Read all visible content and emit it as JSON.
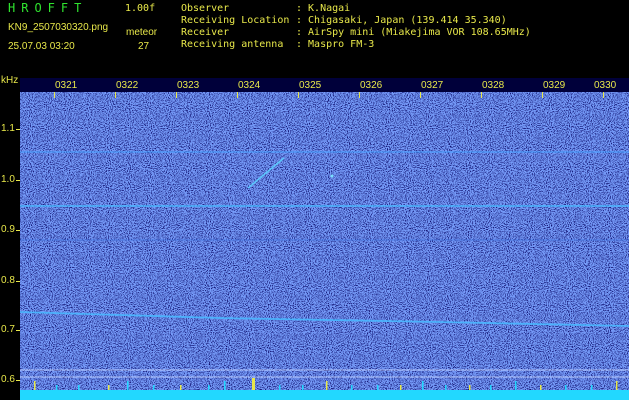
{
  "header": {
    "app_name": "HROFFT",
    "version": "1.00f",
    "filename": "KN9_2507030320.png",
    "mode": "meteor",
    "datetime": "25.07.03 03:20",
    "count": "27"
  },
  "info": [
    {
      "key": "Observer",
      "value": ": K.Nagai"
    },
    {
      "key": "Receiving Location",
      "value": ": Chigasaki, Japan (139.414 35.340)"
    },
    {
      "key": "Receiver",
      "value": ": AirSpy mini (Miakejima VOR 108.65MHz)"
    },
    {
      "key": "Receiving antenna",
      "value": ": Maspro FM-3"
    }
  ],
  "spectrogram": {
    "unit_label": "kHz",
    "freq_labels": [
      "1.1",
      "1.0",
      "0.9",
      "0.8",
      "0.7",
      "0.6"
    ],
    "time_labels": [
      "0321",
      "0322",
      "0323",
      "0324",
      "0325",
      "0326",
      "0327",
      "0328",
      "0329",
      "0330"
    ],
    "colors": {
      "background": "#0a0a6a",
      "noise_bright": "#3a60e0",
      "signal_line": "#3ab0ff",
      "baseline_bar": "#22d8ff",
      "label": "#e8e84a"
    }
  }
}
